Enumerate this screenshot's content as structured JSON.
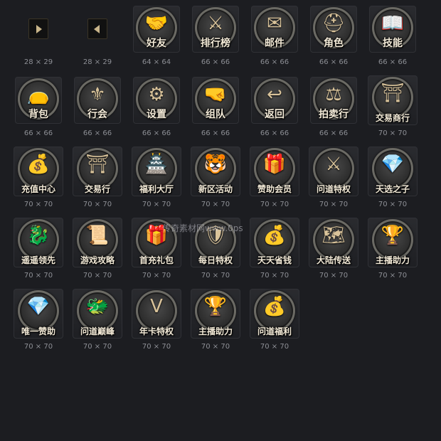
{
  "icons": [
    {
      "label": "",
      "caption": "28 × 29",
      "kind": "arrow-right",
      "glyph": ""
    },
    {
      "label": "",
      "caption": "28 × 29",
      "kind": "arrow-left",
      "glyph": ""
    },
    {
      "label": "好友",
      "caption": "64 × 64",
      "kind": "round",
      "glyph": "🤝"
    },
    {
      "label": "排行榜",
      "caption": "66 × 66",
      "kind": "round",
      "glyph": "⚔"
    },
    {
      "label": "邮件",
      "caption": "66 × 66",
      "kind": "round",
      "glyph": "✉"
    },
    {
      "label": "角色",
      "caption": "66 × 66",
      "kind": "round",
      "glyph": "⛑"
    },
    {
      "label": "技能",
      "caption": "66 × 66",
      "kind": "round",
      "glyph": "📖"
    },
    {
      "label": "背包",
      "caption": "66 × 66",
      "kind": "round",
      "glyph": "👝"
    },
    {
      "label": "行会",
      "caption": "66 × 66",
      "kind": "round",
      "glyph": "⚜"
    },
    {
      "label": "设置",
      "caption": "66 × 66",
      "kind": "round",
      "glyph": "⚙"
    },
    {
      "label": "组队",
      "caption": "66 × 66",
      "kind": "round",
      "glyph": "🤜"
    },
    {
      "label": "返回",
      "caption": "66 × 66",
      "kind": "round",
      "glyph": "↩"
    },
    {
      "label": "拍卖行",
      "caption": "66 × 66",
      "kind": "round",
      "glyph": "⚖"
    },
    {
      "label": "交易商行",
      "caption": "70 × 70",
      "kind": "big",
      "glyph": "⛩"
    },
    {
      "label": "充值中心",
      "caption": "70 × 70",
      "kind": "big",
      "glyph": "💰"
    },
    {
      "label": "交易行",
      "caption": "70 × 70",
      "kind": "big",
      "glyph": "⛩"
    },
    {
      "label": "福利大厅",
      "caption": "70 × 70",
      "kind": "big",
      "glyph": "🏯"
    },
    {
      "label": "新区活动",
      "caption": "70 × 70",
      "kind": "big",
      "glyph": "🐯"
    },
    {
      "label": "赞助会员",
      "caption": "70 × 70",
      "kind": "big",
      "glyph": "🎁"
    },
    {
      "label": "问道特权",
      "caption": "70 × 70",
      "kind": "big",
      "glyph": "⚔"
    },
    {
      "label": "天选之子",
      "caption": "70 × 70",
      "kind": "big",
      "glyph": "💎"
    },
    {
      "label": "遥遥领先",
      "caption": "70 × 70",
      "kind": "big",
      "glyph": "🐉"
    },
    {
      "label": "游戏攻略",
      "caption": "70 × 70",
      "kind": "big",
      "glyph": "📜"
    },
    {
      "label": "首充礼包",
      "caption": "70 × 70",
      "kind": "big",
      "glyph": "🎁"
    },
    {
      "label": "每日特权",
      "caption": "70 × 70",
      "kind": "big",
      "glyph": "🛡"
    },
    {
      "label": "天天省钱",
      "caption": "70 × 70",
      "kind": "big",
      "glyph": "💰"
    },
    {
      "label": "大陆传送",
      "caption": "70 × 70",
      "kind": "big",
      "glyph": "🗺"
    },
    {
      "label": "主播助力",
      "caption": "70 × 70",
      "kind": "big",
      "glyph": "🏆"
    },
    {
      "label": "唯一赞助",
      "caption": "70 × 70",
      "kind": "big",
      "glyph": "💎"
    },
    {
      "label": "问道巅峰",
      "caption": "70 × 70",
      "kind": "big",
      "glyph": "🐲"
    },
    {
      "label": "年卡特权",
      "caption": "70 × 70",
      "kind": "big",
      "glyph": "Ⅴ"
    },
    {
      "label": "主播助力",
      "caption": "70 × 70",
      "kind": "big",
      "glyph": "🏆"
    },
    {
      "label": "问道福利",
      "caption": "70 × 70",
      "kind": "big",
      "glyph": "💰"
    }
  ],
  "watermark": "传奇素材网www.0ps"
}
